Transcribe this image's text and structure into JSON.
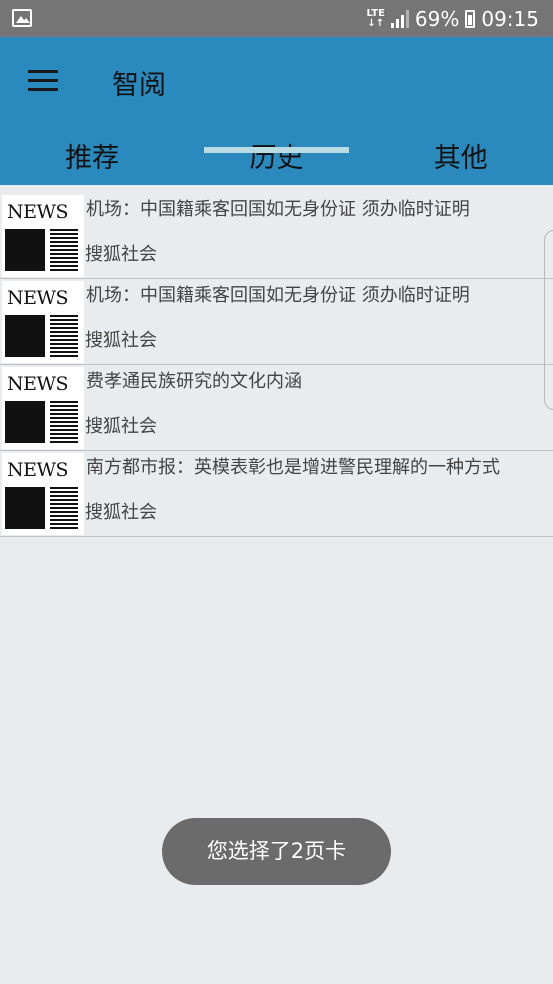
{
  "status_bar": {
    "network": "LTE",
    "battery": "69%",
    "time": "09:15",
    "icons": [
      "gallery-icon",
      "lte-icon",
      "signal-icon",
      "battery-icon"
    ]
  },
  "app_bar": {
    "title": "智阅",
    "menu_icon": "hamburger-menu-icon",
    "color": "#2a89bd"
  },
  "tabs": [
    {
      "label": "推荐"
    },
    {
      "label": "历史"
    },
    {
      "label": "其他"
    }
  ],
  "selected_tab": "历史",
  "news": [
    {
      "thumb_word": "NEWS",
      "title": "机场：中国籍乘客回国如无身份证 须办临时证明",
      "source": "搜狐社会"
    },
    {
      "thumb_word": "NEWS",
      "title": "机场：中国籍乘客回国如无身份证 须办临时证明",
      "source": "搜狐社会"
    },
    {
      "thumb_word": "NEWS",
      "title": "费孝通民族研究的文化内涵",
      "source": "搜狐社会"
    },
    {
      "thumb_word": "NEWS",
      "title": "南方都市报：英模表彰也是增进警民理解的一种方式",
      "source": "搜狐社会"
    }
  ],
  "toast": {
    "text": "您选择了2页卡"
  }
}
